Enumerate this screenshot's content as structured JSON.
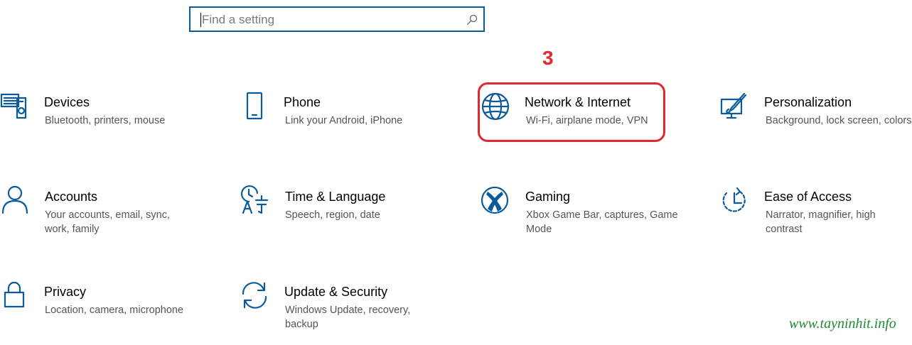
{
  "search": {
    "placeholder": "Find a setting"
  },
  "annotation": {
    "step": "3"
  },
  "tiles": [
    {
      "icon": "devices-icon",
      "title": "Devices",
      "desc": "Bluetooth, printers, mouse"
    },
    {
      "icon": "phone-icon",
      "title": "Phone",
      "desc": "Link your Android, iPhone"
    },
    {
      "icon": "globe-icon",
      "title": "Network & Internet",
      "desc": "Wi-Fi, airplane mode, VPN"
    },
    {
      "icon": "personalization-icon",
      "title": "Personalization",
      "desc": "Background, lock screen, colors"
    },
    {
      "icon": "person-icon",
      "title": "Accounts",
      "desc": "Your accounts, email, sync, work, family"
    },
    {
      "icon": "time-language-icon",
      "title": "Time & Language",
      "desc": "Speech, region, date"
    },
    {
      "icon": "xbox-icon",
      "title": "Gaming",
      "desc": "Xbox Game Bar, captures, Game Mode"
    },
    {
      "icon": "ease-of-access-icon",
      "title": "Ease of Access",
      "desc": "Narrator, magnifier, high contrast"
    },
    {
      "icon": "lock-icon",
      "title": "Privacy",
      "desc": "Location, camera, microphone"
    },
    {
      "icon": "sync-icon",
      "title": "Update & Security",
      "desc": "Windows Update, recovery, backup"
    }
  ],
  "watermark": "www.tayninhit.info",
  "colors": {
    "accent": "#0b5b9c",
    "annotation": "#e0282e",
    "watermark": "#1e8a33"
  }
}
